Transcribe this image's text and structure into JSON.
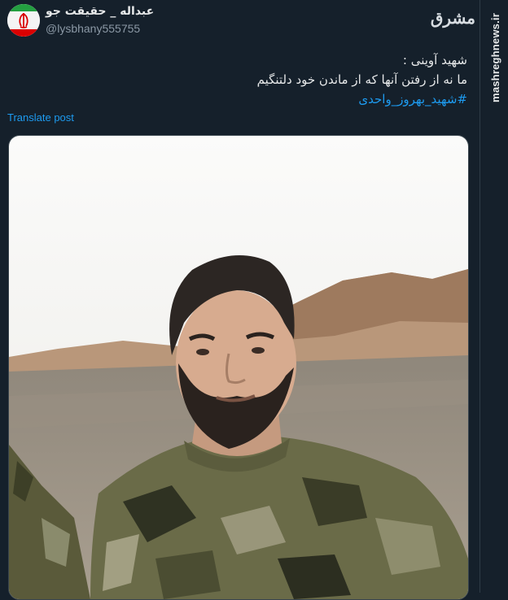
{
  "post": {
    "display_name": "عبداله _ حقیقت جو",
    "handle": "@lysbhany555755",
    "avatar_icon": "iran-flag-emblem-icon",
    "text_line1": "شهید آوینی :",
    "text_line2": "ما نه از رفتن آنها که از ماندن خود دلتنگیم",
    "hashtag": "#شهید_بهروز_واحدی",
    "translate_label": "Translate post",
    "photo_icon": "soldier-portrait-photo"
  },
  "watermark": {
    "logo": "مشرق",
    "site": "mashreghnews.ir"
  },
  "colors": {
    "background": "#15202b",
    "text": "#e7e9ea",
    "secondary": "#8b98a5",
    "accent": "#1d9bf0"
  }
}
